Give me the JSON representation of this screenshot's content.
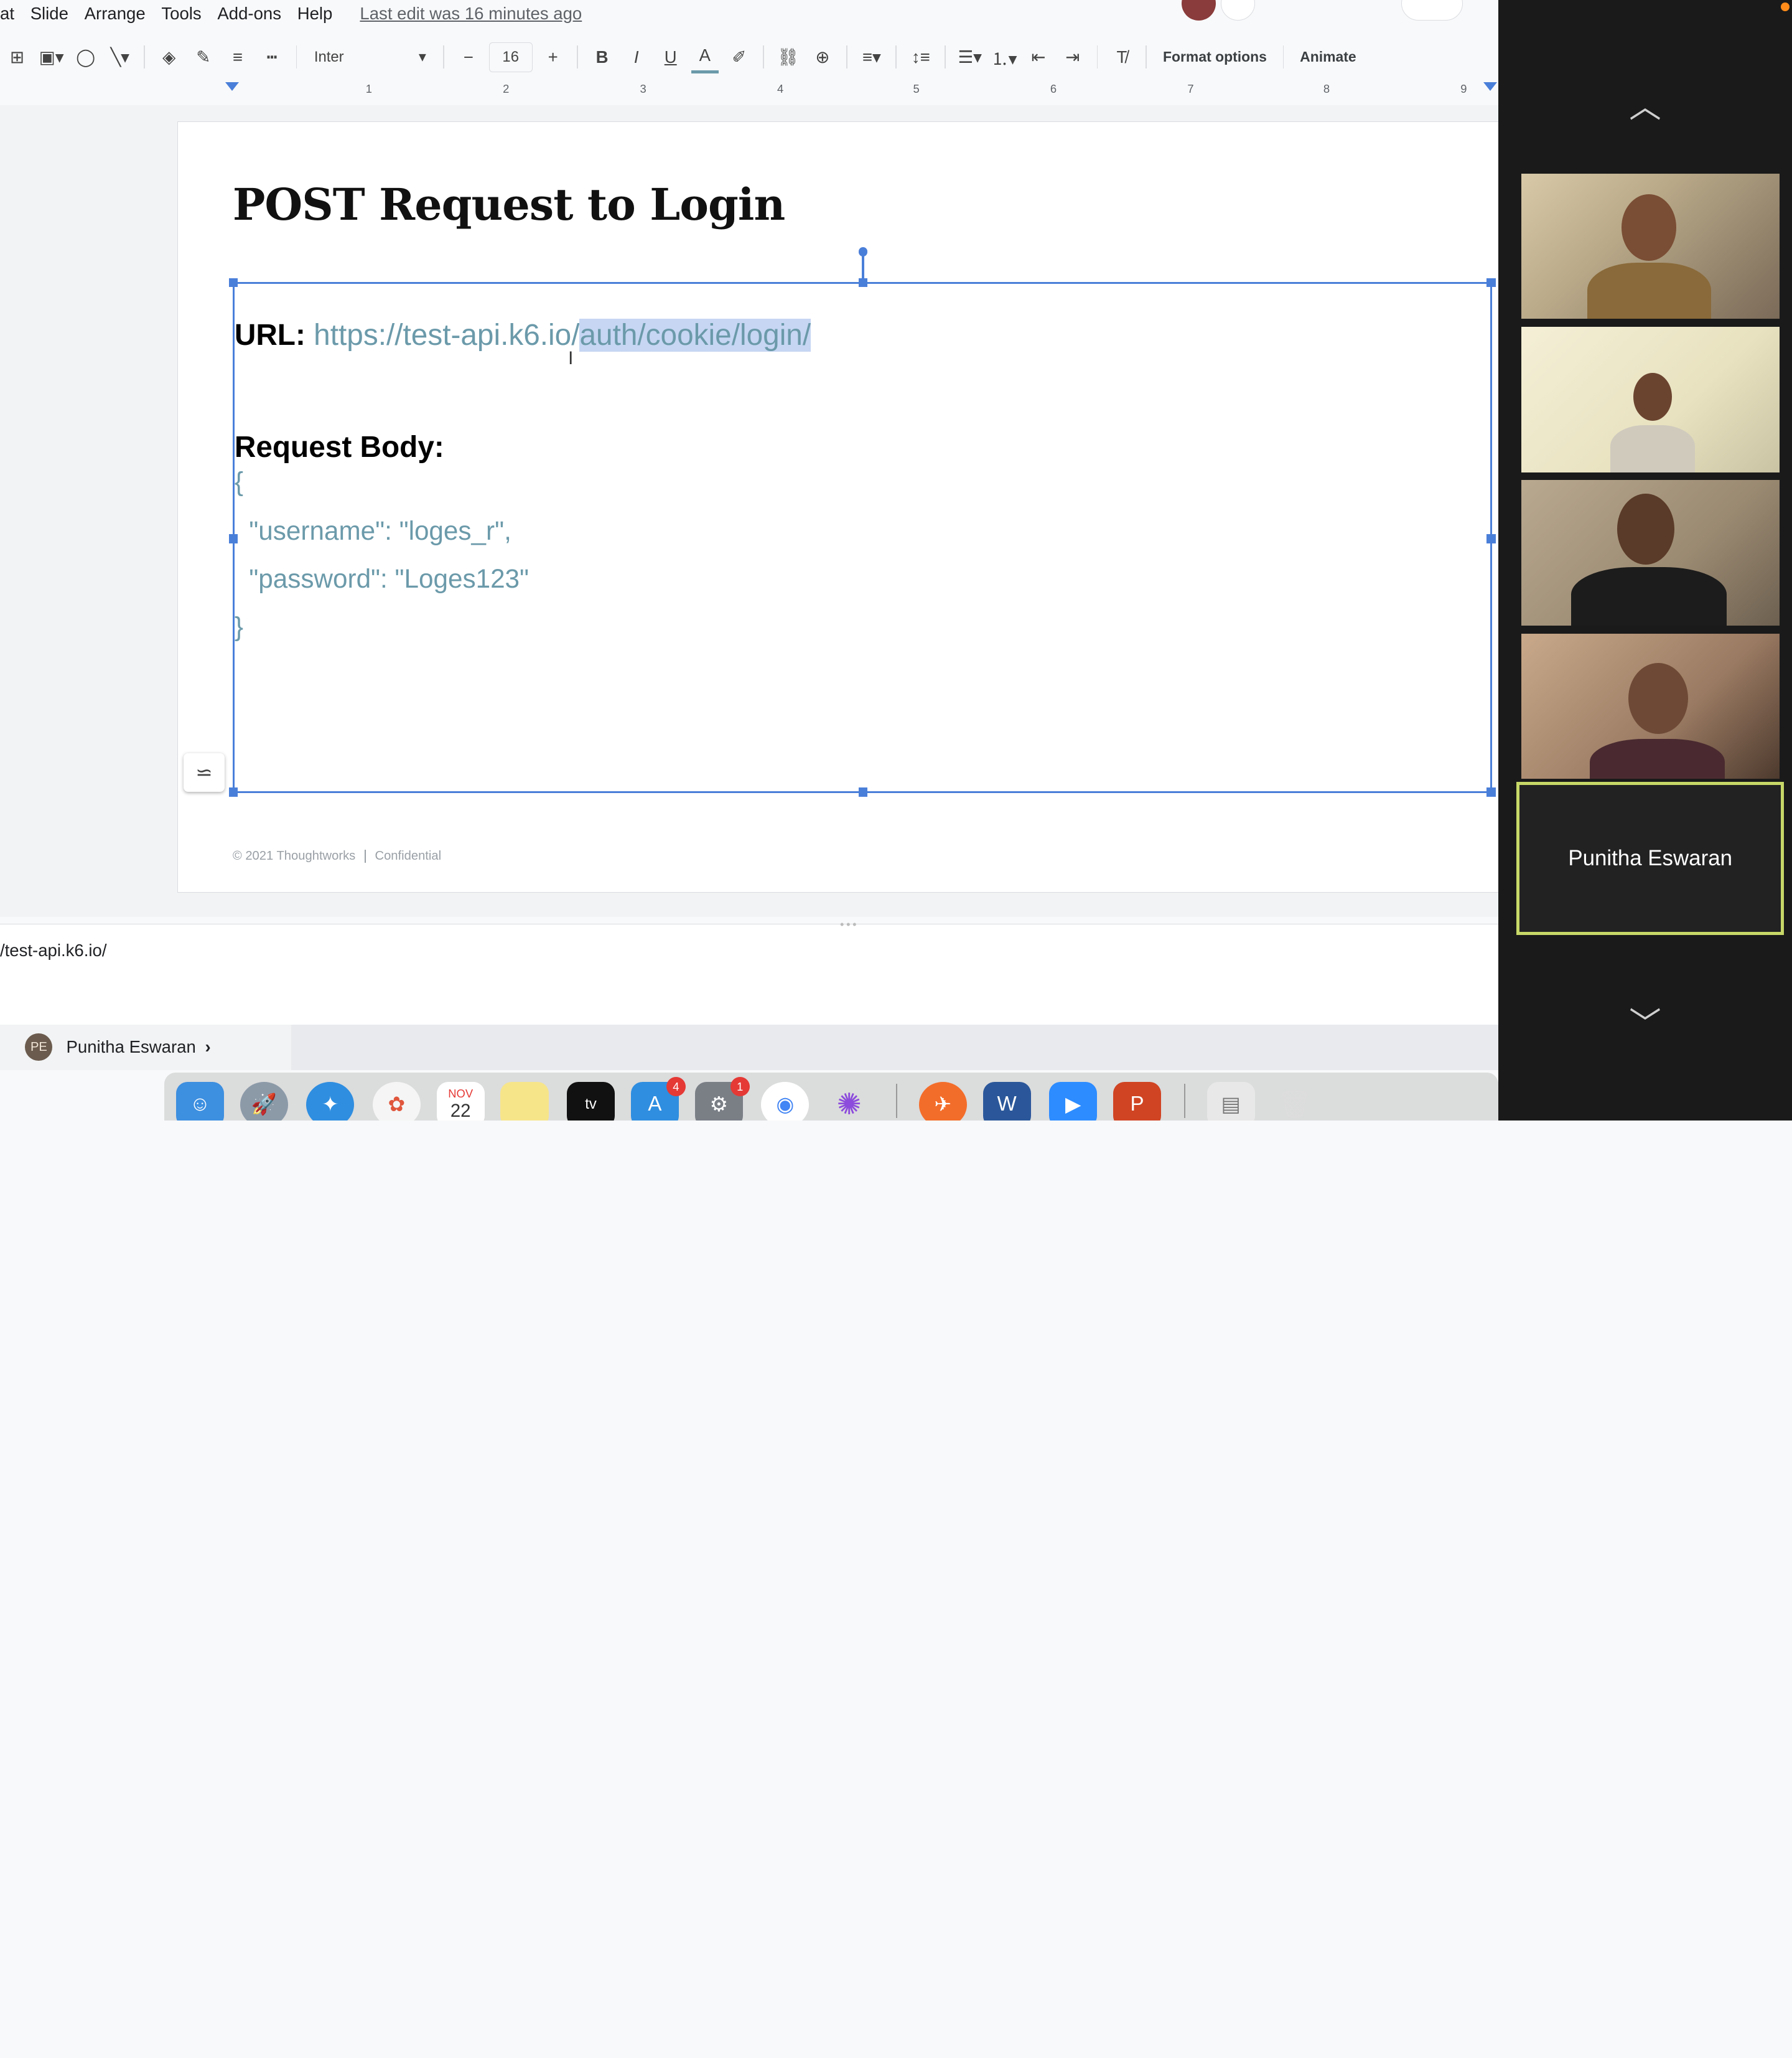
{
  "menubar": {
    "items": [
      "at",
      "Slide",
      "Arrange",
      "Tools",
      "Add-ons",
      "Help"
    ],
    "last_edit": "Last edit was 16 minutes ago"
  },
  "toolbar": {
    "font": "Inter",
    "font_size": "16",
    "format_options": "Format options",
    "animate": "Animate"
  },
  "ruler": {
    "numbers": [
      "1",
      "2",
      "3",
      "4",
      "5",
      "6",
      "7",
      "8",
      "9"
    ]
  },
  "slide": {
    "title": "POST Request to Login",
    "url_label": "URL:",
    "url_plain": "https://test-api.k6.io/",
    "url_selected": "auth/cookie/login/",
    "body_label": "Request Body:",
    "code_lines": [
      "{",
      "  \"username\": \"loges_r\",",
      "  \"password\": \"Loges123\"",
      "}"
    ],
    "footer_copyright": "© 2021 Thoughtworks",
    "footer_conf": "Confidential"
  },
  "notes": {
    "text": "/test-api.k6.io/"
  },
  "bottom": {
    "initials": "PE",
    "name": "Punitha Eswaran"
  },
  "dock": {
    "month": "NOV",
    "day": "22",
    "badge_appstore": "4",
    "badge_settings": "1"
  },
  "video": {
    "active_name": "Punitha Eswaran"
  },
  "colors": {
    "accent": "#4a7fd9",
    "code_text": "#6b9aaa",
    "selection": "#c6d6f3",
    "active_tile_border": "#c8d868"
  }
}
